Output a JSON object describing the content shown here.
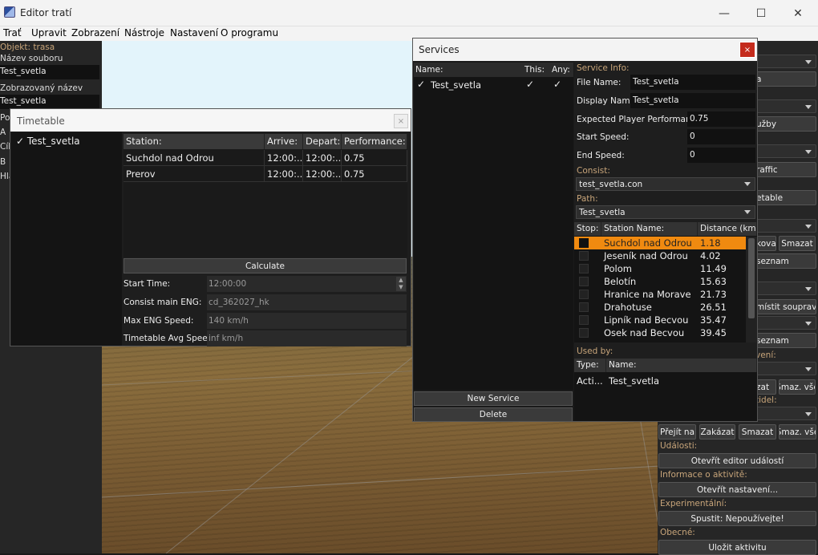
{
  "window": {
    "title": "Editor tratí",
    "controls": [
      "—",
      "☐",
      "✕"
    ]
  },
  "menu": [
    "Trať",
    "Upravit",
    "Zobrazení",
    "Nástroje",
    "Nastavení",
    "O programu"
  ],
  "left_panel": {
    "object_label": "Objekt: trasa",
    "file_name_label": "Název souboru",
    "file_name_value": "Test_svetla",
    "display_name_label": "Zobrazovaný název",
    "display_name_value": "Test_svetla",
    "partial_labels": [
      "Poč",
      "A",
      "Cíl",
      "B",
      "Hla"
    ]
  },
  "timetable": {
    "title": "Timetable",
    "close": "×",
    "service": "✓  Test_svetla",
    "columns": [
      "Station:",
      "Arrive:",
      "Depart:",
      "Performance:"
    ],
    "rows": [
      [
        "Suchdol nad Odrou",
        "12:00:...",
        "12:00:...",
        "0.75"
      ],
      [
        "Prerov",
        "12:00:...",
        "12:00:...",
        "0.75"
      ]
    ],
    "calculate_label": "Calculate",
    "start_time_label": "Start Time:",
    "start_time_value": "12:00:00",
    "consist_eng_label": "Consist main ENG:",
    "consist_eng_value": "cd_362027_hk",
    "max_speed_label": "Max ENG Speed:",
    "max_speed_value": "140 km/h",
    "avg_speed_label": "Timetable Avg Speed:",
    "avg_speed_value": "inf km/h"
  },
  "services": {
    "title": "Services",
    "close": "×",
    "list_headers": [
      "Name:",
      "This:",
      "Any:"
    ],
    "items": [
      {
        "name": "Test_svetla",
        "mark": "✓",
        "this": "✓",
        "any": "✓"
      }
    ],
    "new_service_label": "New Service",
    "delete_label": "Delete",
    "service_info_label": "Service Info:",
    "file_name_label": "File Name:",
    "file_name_value": "Test_svetla",
    "display_name_label": "Display Name:",
    "display_name_value": "Test_svetla",
    "performance_label": "Expected Player Performance:",
    "performance_value": "0.75",
    "start_speed_label": "Start Speed:",
    "start_speed_value": "0",
    "end_speed_label": "End Speed:",
    "end_speed_value": "0",
    "consist_label": "Consist:",
    "consist_value": "test_svetla.con",
    "path_label": "Path:",
    "path_value": "Test_svetla",
    "stations_headers": [
      "Stop:",
      "Station Name:",
      "Distance (km)"
    ],
    "stations": [
      {
        "name": "Suchdol nad Odrou",
        "distance": "1.18"
      },
      {
        "name": "Jeseník nad Odrou",
        "distance": "4.02"
      },
      {
        "name": "Polom",
        "distance": "11.49"
      },
      {
        "name": "Belotín",
        "distance": "15.63"
      },
      {
        "name": "Hranice na Morave",
        "distance": "21.73"
      },
      {
        "name": "Drahotuse",
        "distance": "26.51"
      },
      {
        "name": "Lipník nad Becvou",
        "distance": "35.47"
      },
      {
        "name": "Osek nad Becvou",
        "distance": "39.45"
      }
    ],
    "used_by_label": "Used by:",
    "used_by_headers": [
      "Type:",
      "Name:"
    ],
    "used_by_rows": [
      [
        "Acti...",
        "Test_svetla"
      ]
    ]
  },
  "right_panel": {
    "partial_texts": [
      "a",
      "užby",
      "raffic",
      "etable",
      "kovat",
      "Smazat",
      "seznam",
      "místit soupravu",
      "n",
      "seznam",
      "vení:",
      "zat",
      "Smaz. vše",
      "tidel:"
    ],
    "buttons_row": [
      "Přejít na",
      "Zakázat",
      "Smazat",
      "Smaz. vše"
    ],
    "events_label": "Události:",
    "events_button": "Otevřít editor událostí",
    "activity_info_label": "Informace o aktivitě:",
    "activity_settings_button": "Otevřít nastavení...",
    "experimental_label": "Experimentální:",
    "run_button": "Spustit: Nepoužívejte!",
    "general_label": "Obecné:",
    "save_button": "Uložit aktivitu"
  }
}
